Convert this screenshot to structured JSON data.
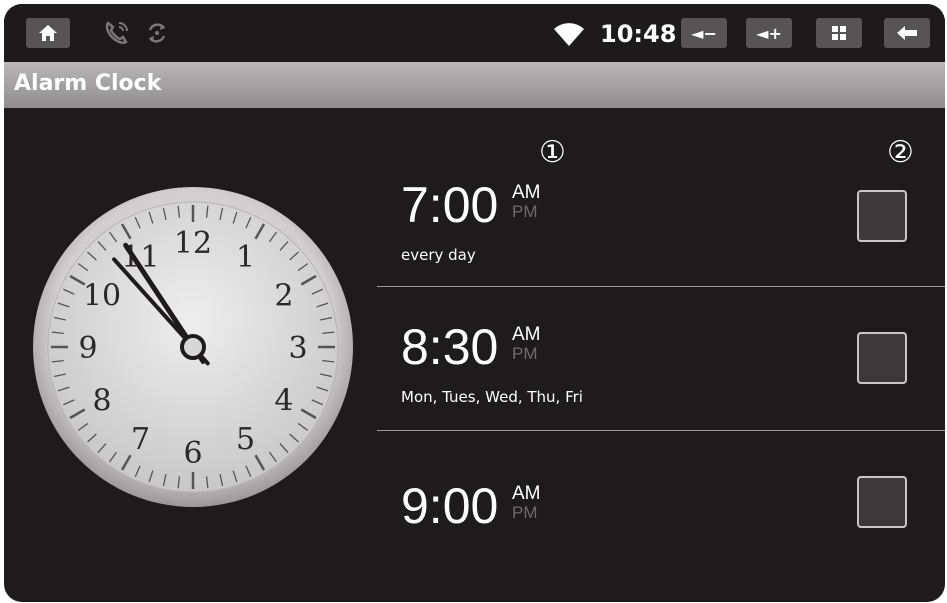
{
  "status_bar": {
    "home_icon": "home-icon",
    "time": "10:48",
    "vol_down_label": "◄−",
    "vol_up_label": "◄+",
    "menu_icon": "grid-icon",
    "back_icon": "back-arrow-icon"
  },
  "app_title": "Alarm Clock",
  "callouts": [
    "①",
    "②"
  ],
  "clock": {
    "numbers": [
      "12",
      "1",
      "2",
      "3",
      "4",
      "5",
      "6",
      "7",
      "8",
      "9",
      "10",
      "11"
    ],
    "hour": 10,
    "minute": 53
  },
  "alarms": [
    {
      "time": "7:00",
      "am": "AM",
      "pm": "PM",
      "days": "every day",
      "enabled": false
    },
    {
      "time": "8:30",
      "am": "AM",
      "pm": "PM",
      "days": "Mon, Tues, Wed, Thu, Fri",
      "enabled": false
    },
    {
      "time": "9:00",
      "am": "AM",
      "pm": "PM",
      "days": "",
      "enabled": false
    }
  ]
}
